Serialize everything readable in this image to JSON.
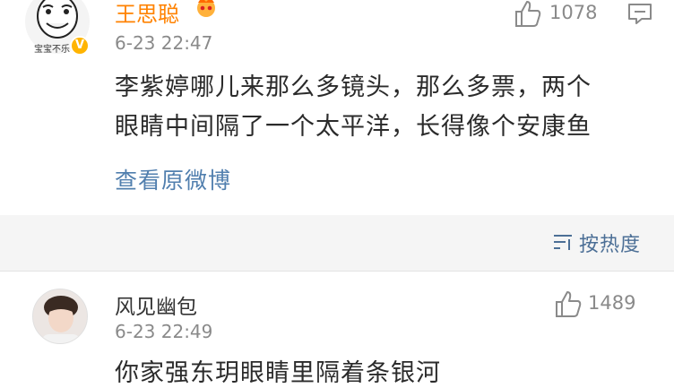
{
  "top_comment": {
    "username": "王思聪",
    "avatar_caption": "宝宝不乐",
    "verified_mark": "V",
    "time": "6-23 22:47",
    "likes": "1078",
    "content_lines": [
      "李紫婷哪儿来那么多镜头，那么多票，两个",
      "眼睛中间隔了一个太平洋，长得像个安康鱼"
    ],
    "view_original_label": "查看原微博"
  },
  "sort": {
    "label": "按热度"
  },
  "second_comment": {
    "username": "风见幽包",
    "time": "6-23 22:49",
    "likes": "1489",
    "content": "你家强东玥眼睛里隔着条银河"
  },
  "colors": {
    "username_orange": "#ff8200",
    "link_blue": "#517fae",
    "sort_blue": "#4c6f96",
    "meta_gray": "#8a8a8a",
    "verified_gold": "#ffb400"
  },
  "icons": [
    "meme-face-avatar",
    "verified-badge-icon",
    "crown-icon",
    "thumbs-up-icon",
    "reply-icon",
    "sort-icon",
    "boy-avatar"
  ]
}
